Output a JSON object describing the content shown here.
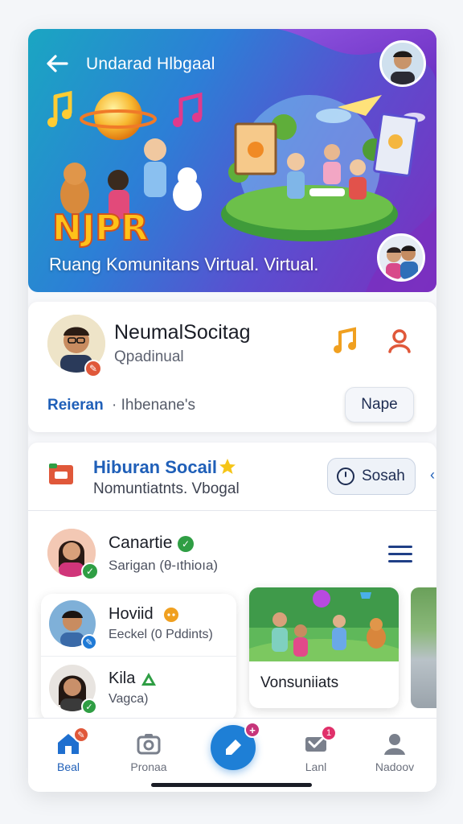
{
  "hero": {
    "title": "Undarad Hlbgaal",
    "caption": "Ruang Komunitans Virtual. Virtual.",
    "logo_text": "NJPR"
  },
  "profile": {
    "name": "NeumalSocitag",
    "subtitle": "Qpadinual",
    "link_label": "Reieran",
    "link_text": "· Ihbenane's",
    "button_label": "Nape"
  },
  "feed": {
    "title": "Hiburan Socail",
    "subtitle": "Nomuntiatnts. Vbogal",
    "search_label": "Sosah",
    "featured_user": {
      "name": "Canartie",
      "subtitle": "Sarigan (θ-ıthioıa)"
    },
    "contacts": [
      {
        "name": "Hoviid",
        "subtitle": "Eeckel (0 Pddints)",
        "status_color": "#f0a020",
        "badge_color": "#1f7ad6"
      },
      {
        "name": "Kila",
        "subtitle": "Vagca)",
        "status_color": "#2f9e44",
        "badge_color": "#2f9e44"
      }
    ],
    "media": {
      "label": "Vonsuniiats"
    }
  },
  "nav": {
    "items": [
      {
        "label": "Beal",
        "icon": "home-icon"
      },
      {
        "label": "Pronaa",
        "icon": "camera-icon"
      },
      {
        "label": "Lanl",
        "icon": "inbox-icon",
        "badge": "1"
      },
      {
        "label": "Nadoov",
        "icon": "profile-icon"
      }
    ],
    "fab_icon": "compose-icon"
  },
  "colors": {
    "accent": "#1f5fb8",
    "fab": "#1e7fd6",
    "orange": "#e0583a",
    "green": "#2f9e44"
  }
}
